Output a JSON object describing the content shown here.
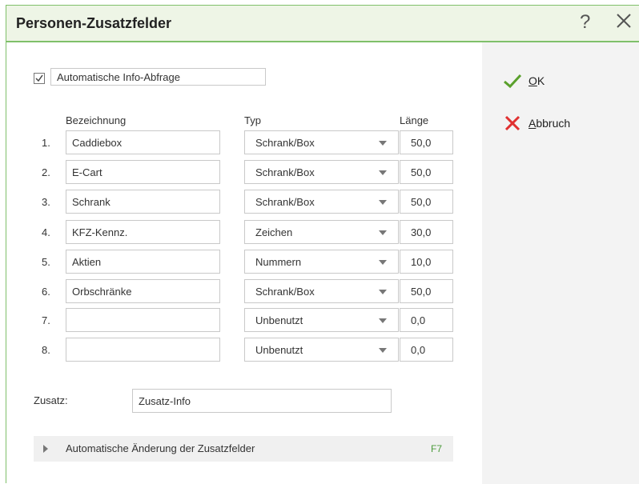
{
  "window": {
    "title": "Personen-Zusatzfelder",
    "help_label": "?"
  },
  "auto_info": {
    "checked": true,
    "label": "Automatische Info-Abfrage"
  },
  "headers": {
    "bezeichnung": "Bezeichnung",
    "typ": "Typ",
    "laenge": "Länge"
  },
  "rows": [
    {
      "num": "1.",
      "name": "Caddiebox",
      "type": "Schrank/Box",
      "length": "50,0"
    },
    {
      "num": "2.",
      "name": "E-Cart",
      "type": "Schrank/Box",
      "length": "50,0"
    },
    {
      "num": "3.",
      "name": "Schrank",
      "type": "Schrank/Box",
      "length": "50,0"
    },
    {
      "num": "4.",
      "name": "KFZ-Kennz.",
      "type": "Zeichen",
      "length": "30,0"
    },
    {
      "num": "5.",
      "name": "Aktien",
      "type": "Nummern",
      "length": "10,0"
    },
    {
      "num": "6.",
      "name": "Orbschränke",
      "type": "Schrank/Box",
      "length": "50,0"
    },
    {
      "num": "7.",
      "name": "",
      "type": "Unbenutzt",
      "length": "0,0"
    },
    {
      "num": "8.",
      "name": "",
      "type": "Unbenutzt",
      "length": "0,0"
    }
  ],
  "zusatz": {
    "label": "Zusatz:",
    "value": "Zusatz-Info"
  },
  "expander": {
    "label": "Automatische Änderung der Zusatzfelder",
    "shortcut": "F7"
  },
  "actions": {
    "ok_first": "O",
    "ok_rest": "K",
    "cancel_first": "A",
    "cancel_rest": "bbruch"
  },
  "colors": {
    "accent": "#7fc06a",
    "ok": "#5aa02c",
    "cancel": "#e03030"
  }
}
